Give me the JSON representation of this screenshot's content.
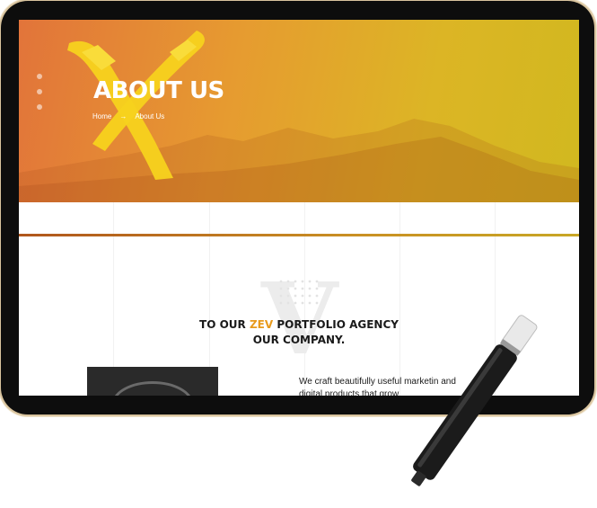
{
  "hero": {
    "title": "ABOUT US",
    "breadcrumb": {
      "home": "Home",
      "separator": "→",
      "current": "About Us"
    }
  },
  "section": {
    "headline_pre": "TO OUR ",
    "headline_accent": "ZEV",
    "headline_post": " PORTFOLIO AGENCY",
    "headline_line2": "OUR COMPANY.",
    "description": "We craft beautifully useful marketin and digital products that grow"
  },
  "colors": {
    "accent": "#e89a1c",
    "hero_gradient_start": "#e2743a",
    "hero_gradient_end": "#d1b81f",
    "brush_yellow": "#f7d21e"
  }
}
